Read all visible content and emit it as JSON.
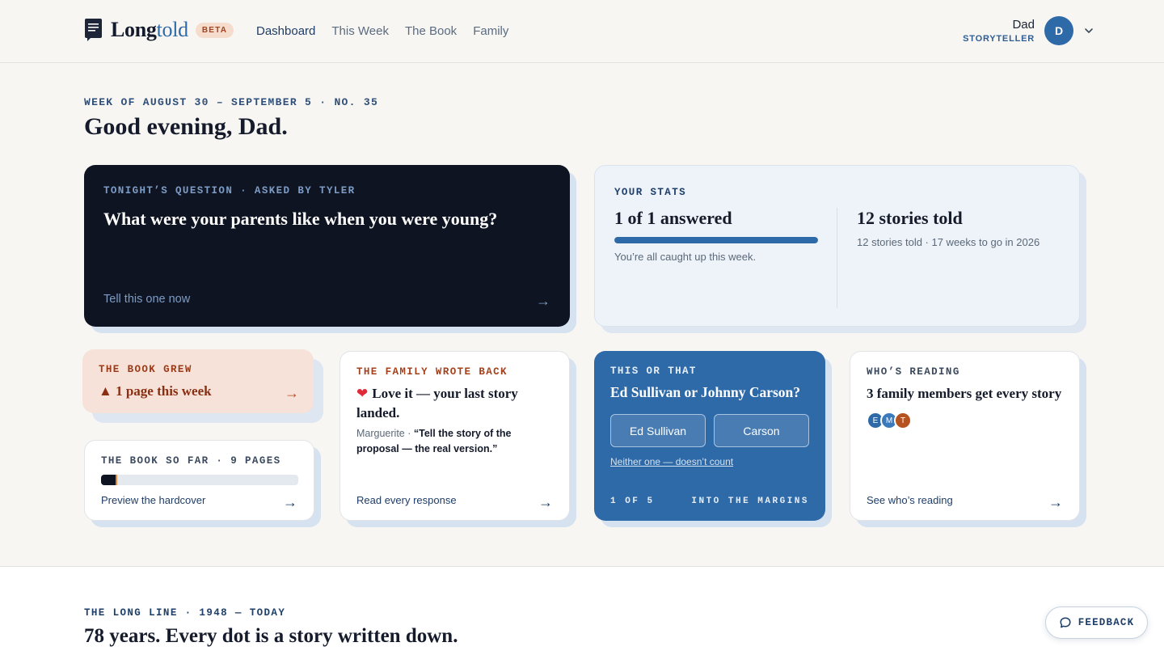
{
  "header": {
    "logo_part1": "Long",
    "logo_part2": "told",
    "beta": "BETA",
    "nav": [
      {
        "label": "Dashboard",
        "active": true
      },
      {
        "label": "This Week",
        "active": false
      },
      {
        "label": "The Book",
        "active": false
      },
      {
        "label": "Family",
        "active": false
      }
    ],
    "user": {
      "name": "Dad",
      "role": "STORYTELLER",
      "initial": "D"
    }
  },
  "greeting": {
    "week": "WEEK OF AUGUST 30 – SEPTEMBER 5 · NO. 35",
    "title": "Good evening, Dad."
  },
  "question": {
    "eyebrow": "TONIGHT’S QUESTION · ASKED BY TYLER",
    "title": "What were your parents like when you were young?",
    "link": "Tell this one now",
    "arrow": "→"
  },
  "stats": {
    "eyebrow": "YOUR STATS",
    "answered": "1 of 1 answered",
    "answered_progress": 1.0,
    "answered_sub": "You’re all caught up this week.",
    "stories": "12 stories told",
    "stories_sub": "12 stories told · 17 weeks to go in 2026"
  },
  "book_grew": {
    "eyebrow": "THE BOOK GREW",
    "text": "▲ 1 page this week",
    "arrow": "→"
  },
  "book_so_far": {
    "eyebrow": "THE BOOK SO FAR · 9 PAGES",
    "progress": 0.08,
    "link": "Preview the hardcover",
    "arrow": "→"
  },
  "family_wrote": {
    "eyebrow": "THE FAMILY WROTE BACK",
    "heart": "❤",
    "title": "Love it — your last story landed.",
    "author": "Marguerite · ",
    "quote": "“Tell the story of the proposal — the real version.”",
    "link": "Read every response",
    "arrow": "→"
  },
  "this_or_that": {
    "eyebrow": "THIS OR THAT",
    "title": "Ed Sullivan or Johnny Carson?",
    "option_a": "Ed Sullivan",
    "option_b": "Carson",
    "neither": "Neither one — doesn’t count",
    "counter": "1 OF 5",
    "footer_right": "INTO THE MARGINS"
  },
  "whos_reading": {
    "eyebrow": "WHO’S READING",
    "title": "3 family members get every story",
    "readers": [
      {
        "initial": "E",
        "color": "#2f6aa8"
      },
      {
        "initial": "M",
        "color": "#3b79bd"
      },
      {
        "initial": "T",
        "color": "#b5521f"
      }
    ],
    "link": "See who’s reading",
    "arrow": "→"
  },
  "long_line": {
    "eyebrow": "THE LONG LINE · 1948 — TODAY",
    "title": "78 years. Every dot is a story written down."
  },
  "feedback": {
    "label": "FEEDBACK"
  }
}
